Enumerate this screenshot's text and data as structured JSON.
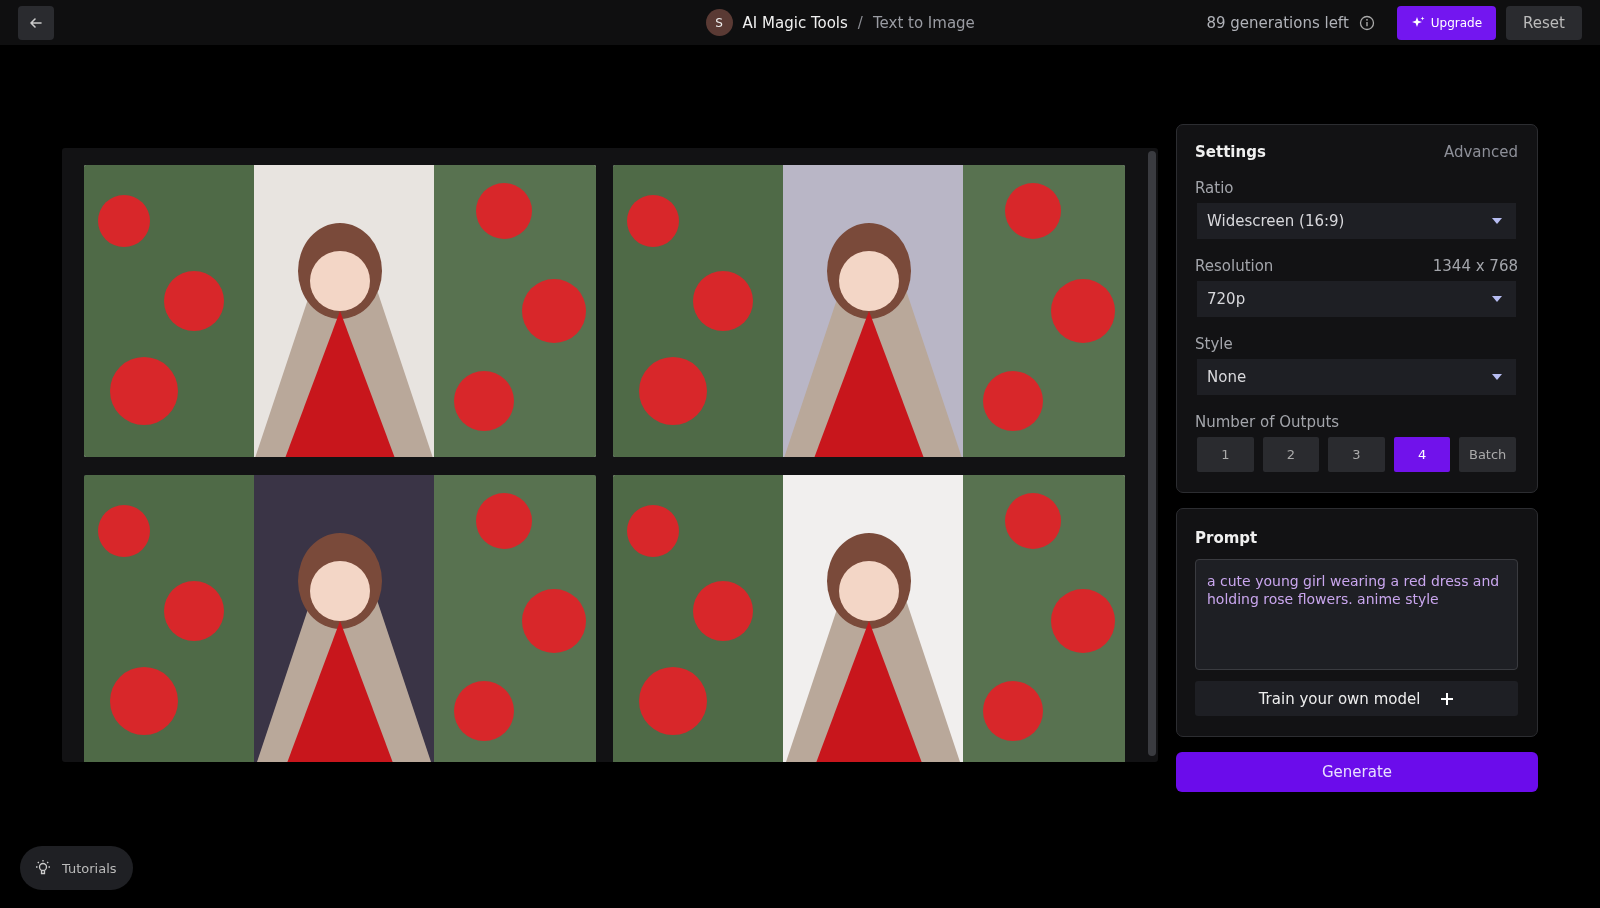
{
  "topbar": {
    "avatar": "S",
    "breadcrumb": [
      "AI Magic Tools",
      "Text to Image"
    ],
    "separator": "/",
    "generations": "89 generations left",
    "upgrade": "Upgrade",
    "reset": "Reset"
  },
  "settings": {
    "title": "Settings",
    "advanced": "Advanced",
    "fields": [
      {
        "label": "Ratio",
        "value": "Widescreen (16:9)"
      },
      {
        "label": "Resolution",
        "reading": "1344 x 768",
        "value": "720p"
      },
      {
        "label": "Style",
        "value": "None"
      }
    ],
    "outputs": {
      "label": "Number of Outputs",
      "options": [
        {
          "label": "1",
          "selected": false
        },
        {
          "label": "2",
          "selected": false
        },
        {
          "label": "3",
          "selected": false
        },
        {
          "label": "4",
          "selected": true
        },
        {
          "label": "Batch",
          "selected": false
        }
      ]
    }
  },
  "prompt": {
    "title": "Prompt",
    "value": "a cute young girl wearing a red dress and holding rose flowers. anime style",
    "train": "Train your own model"
  },
  "generate": "Generate",
  "tutorials": "Tutorials"
}
